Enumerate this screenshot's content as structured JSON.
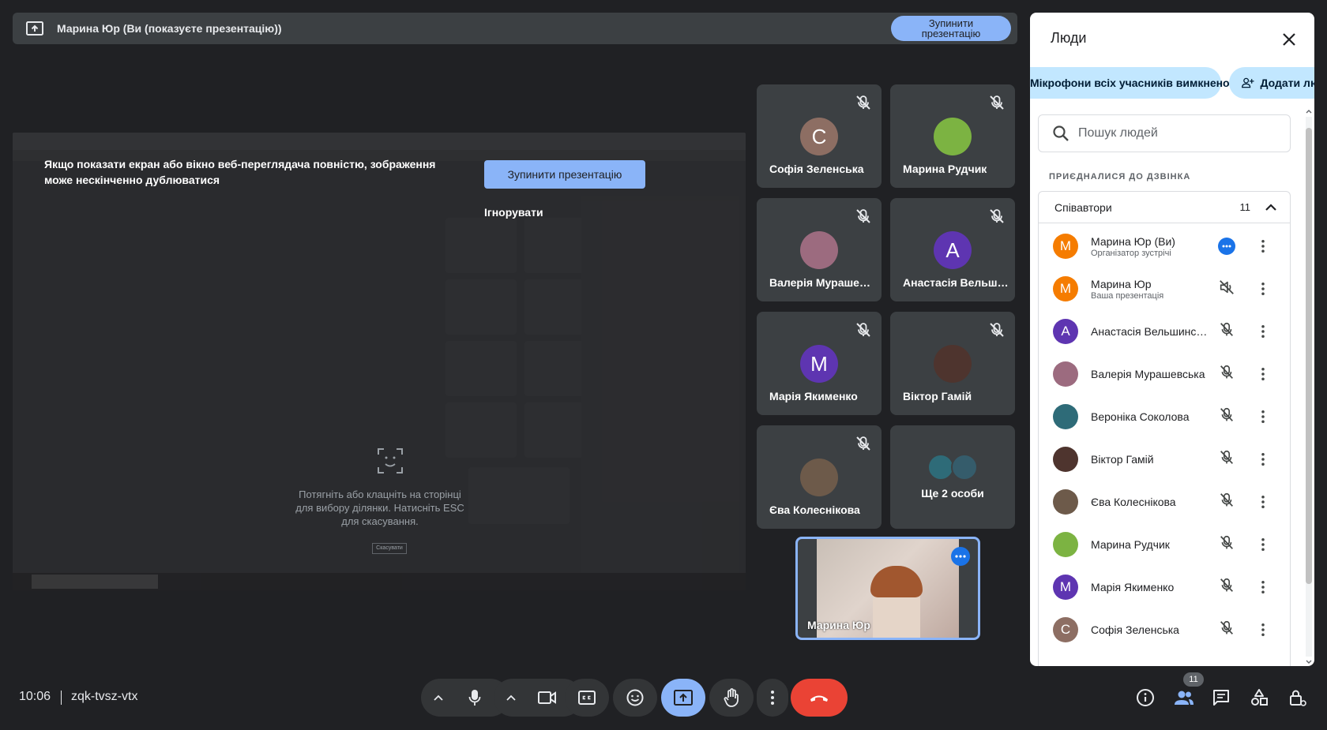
{
  "topbar": {
    "title": "Марина Юр (Ви (показуєте презентацію))",
    "stop_label": "Зупинити презентацію"
  },
  "warning": {
    "text": "Якщо показати екран або вікно веб-переглядача повністю, зображення може нескінченно дублюватися",
    "stop_label": "Зупинити презентацію",
    "ignore_label": "Ігнорувати"
  },
  "shared_screen": {
    "crop_hint": "Потягніть або клацніть на сторінці для вибору ділянки. Натисніть ESC для скасування.",
    "cancel_label": "Скасувати"
  },
  "tiles": [
    {
      "name": "Софія Зеленська",
      "initial": "С",
      "color": "#8d6e63"
    },
    {
      "name": "Марина Рудчик",
      "initial": "",
      "color": "#7cb342"
    },
    {
      "name": "Валерія Мурашевська",
      "initial": "",
      "color": "#9c6b7f"
    },
    {
      "name": "Анастасія Вельшинська",
      "initial": "А",
      "color": "#5e35b1"
    },
    {
      "name": "Марія Якименко",
      "initial": "М",
      "color": "#5e35b1"
    },
    {
      "name": "Віктор Гамій",
      "initial": "",
      "color": "#4e342e"
    },
    {
      "name": "Єва Колеснікова",
      "initial": "",
      "color": "#6d5a4a"
    }
  ],
  "more_tile": {
    "label": "Ще 2 особи"
  },
  "self_tile": {
    "name": "Марина Юр"
  },
  "bottom": {
    "time": "10:06",
    "meeting_code": "zqk-tvsz-vtx",
    "people_badge": "11"
  },
  "people_panel": {
    "title": "Люди",
    "mute_chip": "Мікрофони всіх учасників вимкнено",
    "add_chip": "Додати людей",
    "search_placeholder": "Пошук людей",
    "section_label": "ПРИЄДНАЛИСЯ ДО ДЗВІНКА",
    "group_label": "Співавтори",
    "group_count": "11",
    "people": [
      {
        "name": "Марина Юр (Ви)",
        "sub": "Організатор зустрічі",
        "initial": "М",
        "color": "#f57c00"
      },
      {
        "name": "Марина Юр",
        "sub": "Ваша презентація",
        "initial": "М",
        "color": "#f57c00"
      },
      {
        "name": "Анастасія Вельшинська",
        "sub": "",
        "initial": "А",
        "color": "#5e35b1"
      },
      {
        "name": "Валерія Мурашевська",
        "sub": "",
        "initial": "",
        "color": "#9c6b7f"
      },
      {
        "name": "Вероніка Соколова",
        "sub": "",
        "initial": "",
        "color": "#2e6b78"
      },
      {
        "name": "Віктор Гамій",
        "sub": "",
        "initial": "",
        "color": "#4e342e"
      },
      {
        "name": "Єва Колеснікова",
        "sub": "",
        "initial": "",
        "color": "#6d5a4a"
      },
      {
        "name": "Марина Рудчик",
        "sub": "",
        "initial": "",
        "color": "#7cb342"
      },
      {
        "name": "Марія Якименко",
        "sub": "",
        "initial": "М",
        "color": "#5e35b1"
      },
      {
        "name": "Софія Зеленська",
        "sub": "",
        "initial": "С",
        "color": "#8d6e63"
      }
    ]
  }
}
